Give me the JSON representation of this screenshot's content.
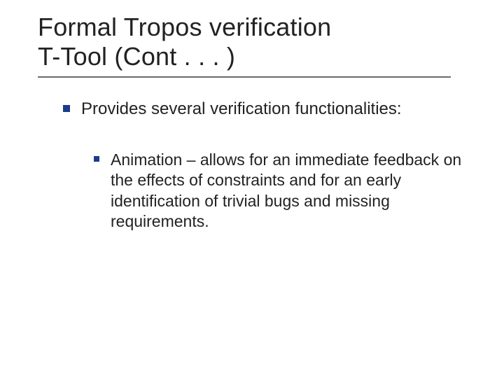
{
  "title_line1": "Formal Tropos verification",
  "title_line2": "T-Tool (Cont . . . )",
  "bullets": {
    "level1": "Provides several verification functionalities:",
    "level2": "Animation – allows for an immediate feedback on the effects of constraints and for an early identification of trivial bugs and missing requirements."
  }
}
